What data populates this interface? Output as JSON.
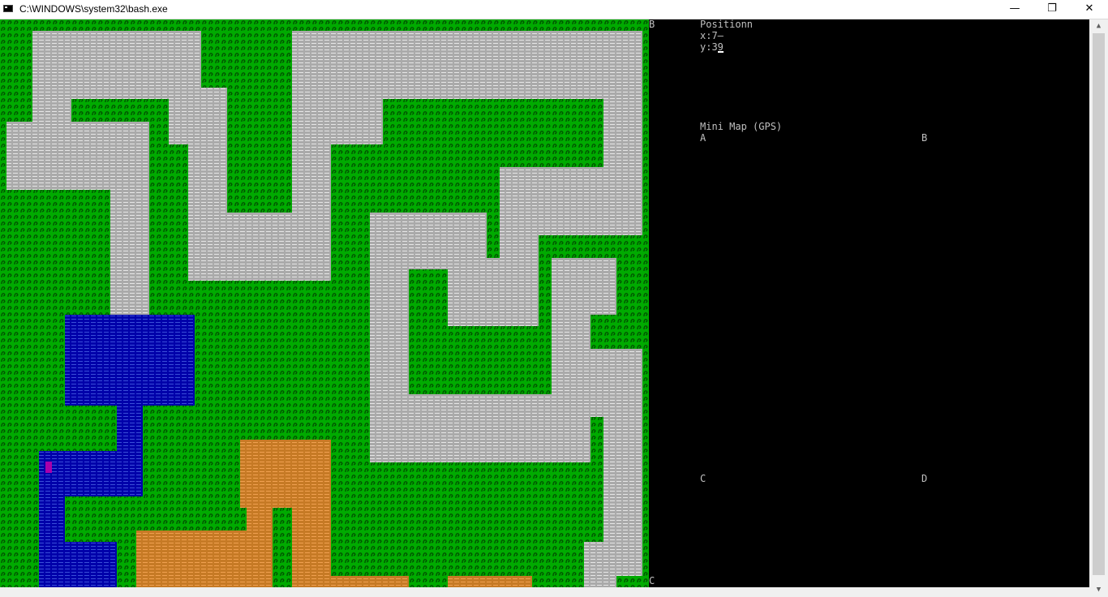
{
  "window": {
    "title": "C:\\WINDOWS\\system32\\bash.exe",
    "icon": "console-icon",
    "controls": {
      "minimize": "—",
      "maximize": "❐",
      "close": "✕"
    }
  },
  "colors": {
    "grass": "#00aa00",
    "grass_dark": "#005500",
    "road": "#aaaaaa",
    "road_line": "#e6e6e6",
    "water": "#0000aa",
    "water_line": "#3a4fd8",
    "sand": "#c67a25",
    "sand_line": "#f0a050",
    "player": "#aa00aa",
    "console_text": "#c0c0c0",
    "background": "#000000"
  },
  "map_labels": {
    "corner_b": "B",
    "corner_c": "C"
  },
  "hud": {
    "position_title": "Positionn",
    "x_line": "x:7–",
    "y_line": "y:39",
    "minimap_title": "Mini Map (GPS)",
    "minimap_a": "A",
    "minimap_b": "B",
    "minimap_c": "C",
    "minimap_d": "D"
  },
  "scrollbar": {
    "up": "▲",
    "down": "▼"
  }
}
